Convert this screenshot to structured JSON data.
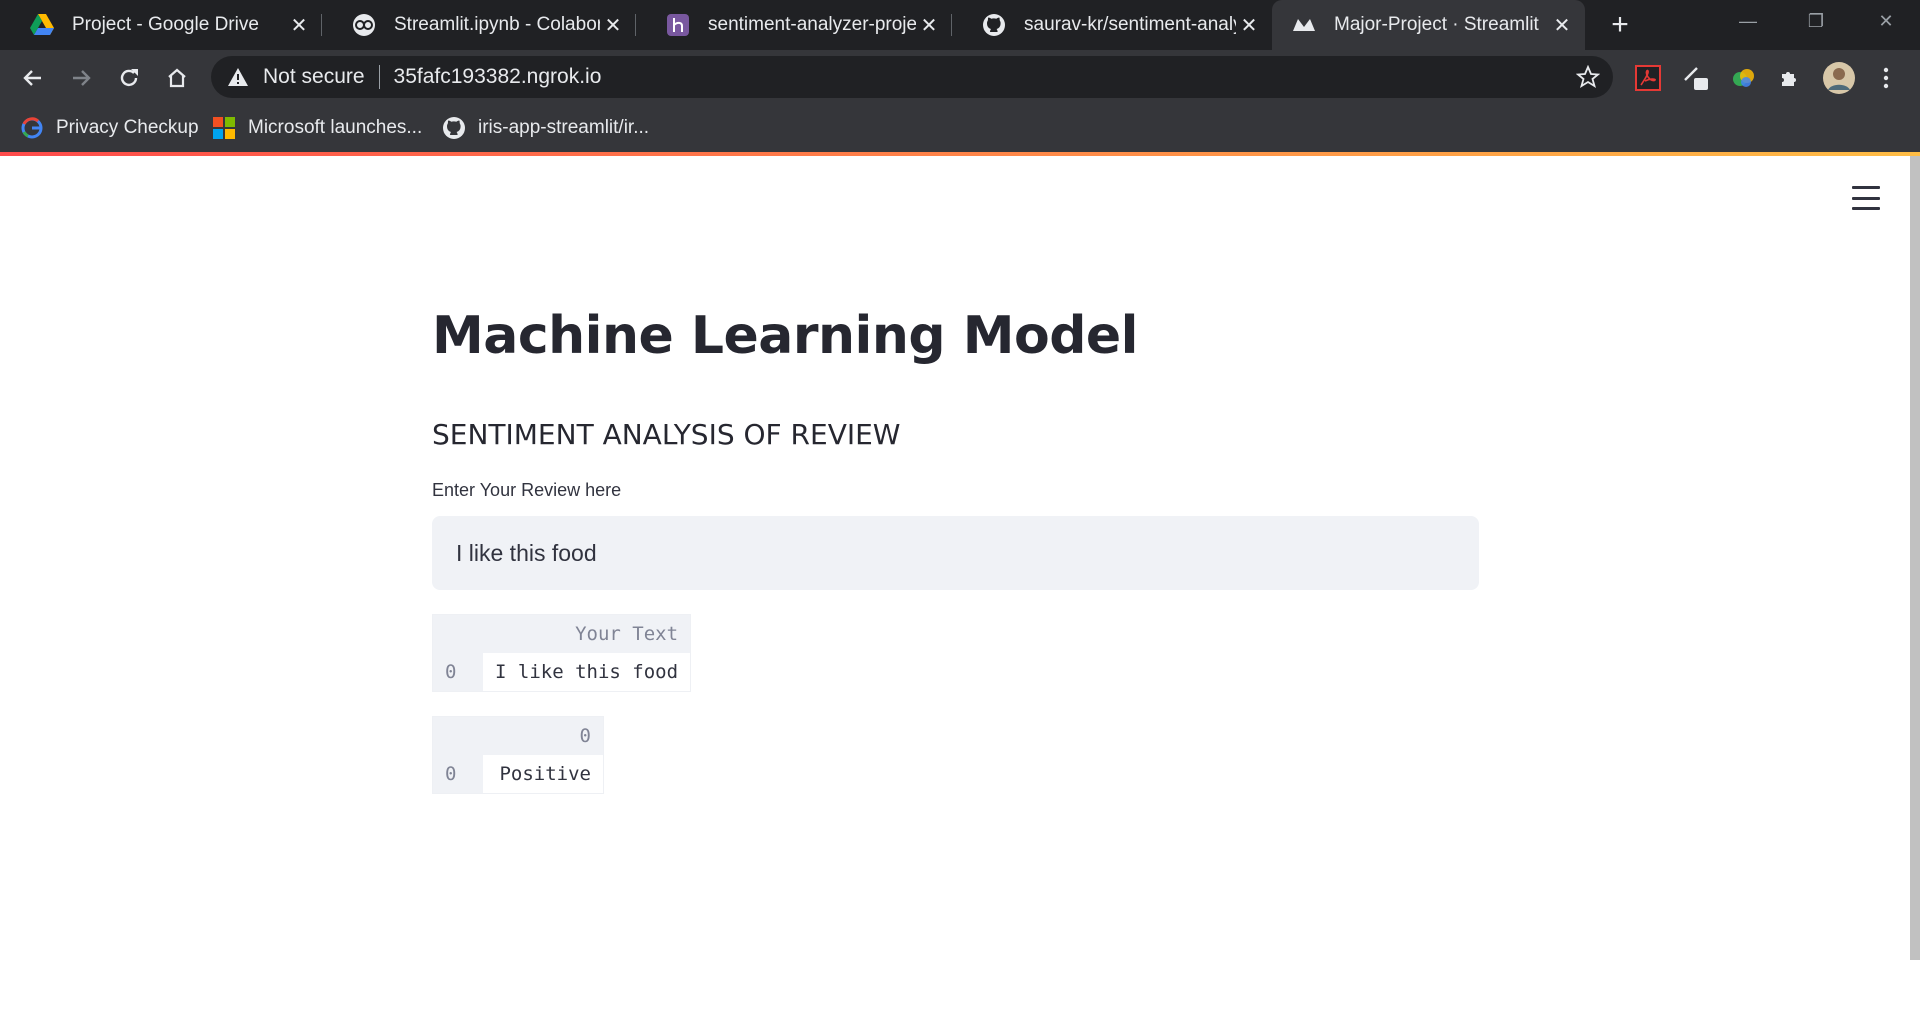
{
  "browser": {
    "tabs": [
      {
        "title": "Project - Google Drive",
        "icon": "google-drive-icon",
        "active": false
      },
      {
        "title": "Streamlit.ipynb - Colaborato",
        "icon": "colab-icon",
        "active": false
      },
      {
        "title": "sentiment-analyzer-project",
        "icon": "heroku-icon",
        "active": false
      },
      {
        "title": "saurav-kr/sentiment-analyz",
        "icon": "github-icon",
        "active": false
      },
      {
        "title": "Major-Project · Streamlit",
        "icon": "streamlit-icon",
        "active": true
      }
    ],
    "address": {
      "security_label": "Not secure",
      "url": "35fafc193382.ngrok.io"
    },
    "bookmarks": [
      {
        "label": "Privacy Checkup",
        "icon": "google-icon"
      },
      {
        "label": "Microsoft launches...",
        "icon": "microsoft-icon"
      },
      {
        "label": "iris-app-streamlit/ir...",
        "icon": "github-icon"
      }
    ]
  },
  "app": {
    "title": "Machine Learning Model",
    "subtitle": "SENTIMENT ANALYSIS OF REVIEW",
    "input_label": "Enter Your Review here",
    "input_value": "I like this food",
    "table1": {
      "column": "Your Text",
      "rows": [
        {
          "index": "0",
          "value": "I like this food"
        }
      ]
    },
    "table2": {
      "column": "0",
      "rows": [
        {
          "index": "0",
          "value": "Positive"
        }
      ]
    }
  }
}
